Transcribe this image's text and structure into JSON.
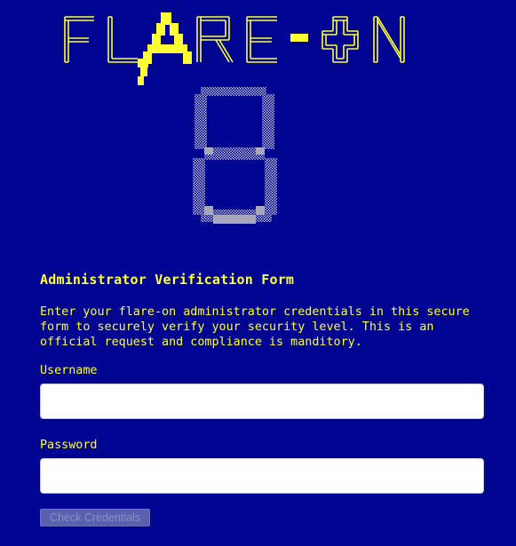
{
  "logo": {
    "text": "FLARE-ON",
    "edition": "8",
    "primary_color": "#ffff33",
    "digit_color": "#a0a0b8"
  },
  "form": {
    "title": "Administrator Verification Form",
    "description": "Enter your flare-on administrator credentials in this secure form to securely verify your security level. This is an official request and compliance is manditory.",
    "username_label": "Username",
    "username_value": "",
    "password_label": "Password",
    "password_value": "",
    "submit_label": "Check Credentials",
    "submit_disabled": true
  },
  "colors": {
    "background": "#000591",
    "text": "#ffff33",
    "input_bg": "#ffffff",
    "button_bg": "#5a5fb0"
  }
}
